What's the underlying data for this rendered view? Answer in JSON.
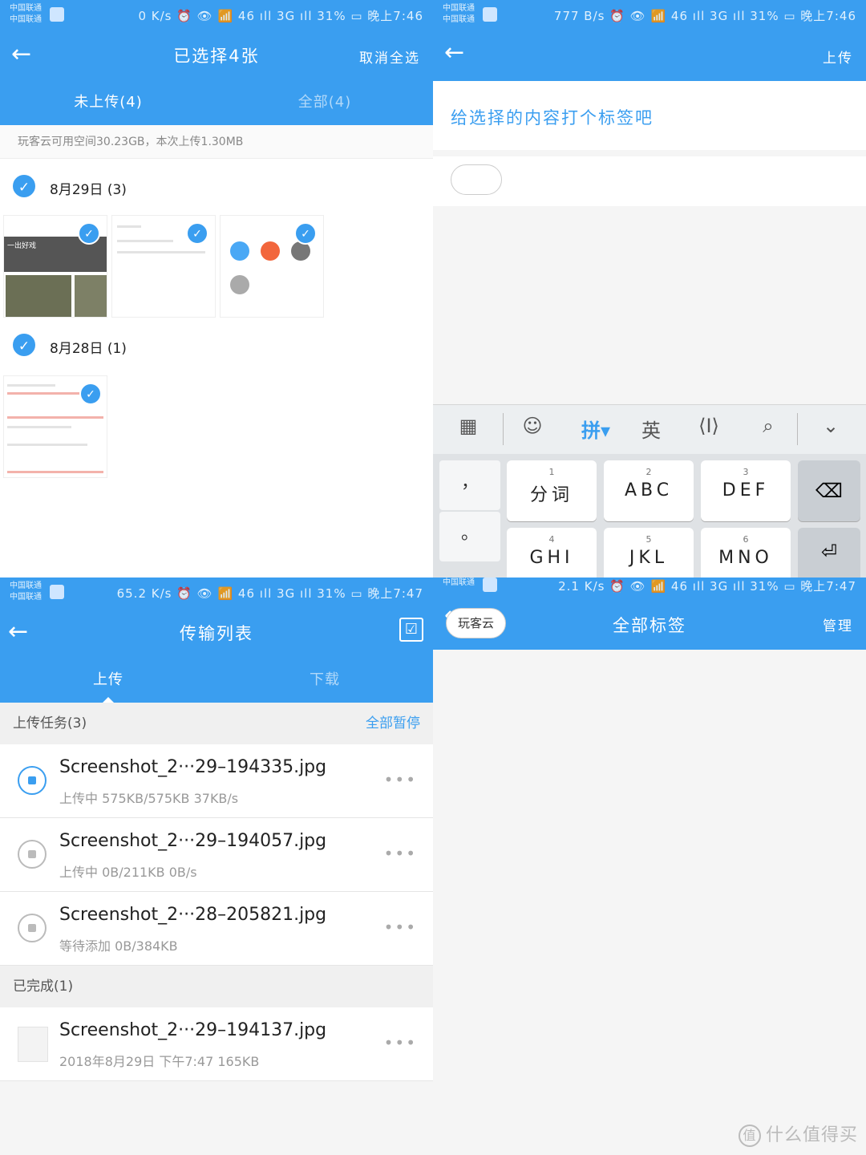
{
  "colors": {
    "accent": "#3a9ef0"
  },
  "status": {
    "carrier1": "中国联通",
    "carrier2": "中国联通",
    "p1": "0 K/s ⏰ 👁 📶 46 ıll 3G ıll 31% ▭ 晚上7:46",
    "p2": "777 B/s ⏰ 👁 📶 46 ıll 3G ıll 31% ▭ 晚上7:46",
    "p3": "65.2 K/s ⏰ 👁 📶 46 ıll 3G ıll 31% ▭ 晚上7:47",
    "p4": "2.1 K/s ⏰ 👁 📶 46 ıll 3G ıll 31% ▭ 晚上7:47"
  },
  "select_screen": {
    "title": "已选择4张",
    "cancel_all": "取消全选",
    "tab_not_uploaded": "未上传(4)",
    "tab_all": "全部(4)",
    "info": "玩客云可用空间30.23GB，本次上传1.30MB",
    "groups": [
      {
        "date": "8月29日  (3)"
      },
      {
        "date": "8月28日  (1)"
      }
    ],
    "thumb1": {
      "header": "一出好戏"
    }
  },
  "tag_screen": {
    "upload": "上传",
    "prompt": "给选择的内容打个标签吧",
    "keyboard": {
      "tools": [
        "grid-icon",
        "emoji-icon",
        "拼▾",
        "英",
        "cursor-icon",
        "search-icon",
        "collapse-icon"
      ],
      "pinyin": "拼",
      "english": "英",
      "side_keys": [
        "，",
        "。"
      ],
      "keys": [
        {
          "num": "1",
          "label": "分词"
        },
        {
          "num": "2",
          "label": "ABC"
        },
        {
          "num": "3",
          "label": "DEF"
        },
        {
          "num": "4",
          "label": "GHI"
        },
        {
          "num": "5",
          "label": "JKL"
        },
        {
          "num": "6",
          "label": "MNO"
        }
      ]
    }
  },
  "transfer_screen": {
    "title": "传输列表",
    "tab_upload": "上传",
    "tab_download": "下载",
    "tasks_header": "上传任务(3)",
    "pause_all": "全部暂停",
    "tasks": [
      {
        "name": "Screenshot_2···29–194335.jpg",
        "status": "上传中 575KB/575KB 37KB/s"
      },
      {
        "name": "Screenshot_2···29–194057.jpg",
        "status": "上传中 0B/211KB 0B/s"
      },
      {
        "name": "Screenshot_2···28–205821.jpg",
        "status": "等待添加 0B/384KB"
      }
    ],
    "done_header": "已完成(1)",
    "done": [
      {
        "name": "Screenshot_2···29–194137.jpg",
        "status": "2018年8月29日  下午7:47    165KB"
      }
    ]
  },
  "tags_screen": {
    "title": "全部标签",
    "manage": "管理",
    "tag": "玩客云"
  },
  "watermark": "什么值得买",
  "watermark_icon": "值"
}
